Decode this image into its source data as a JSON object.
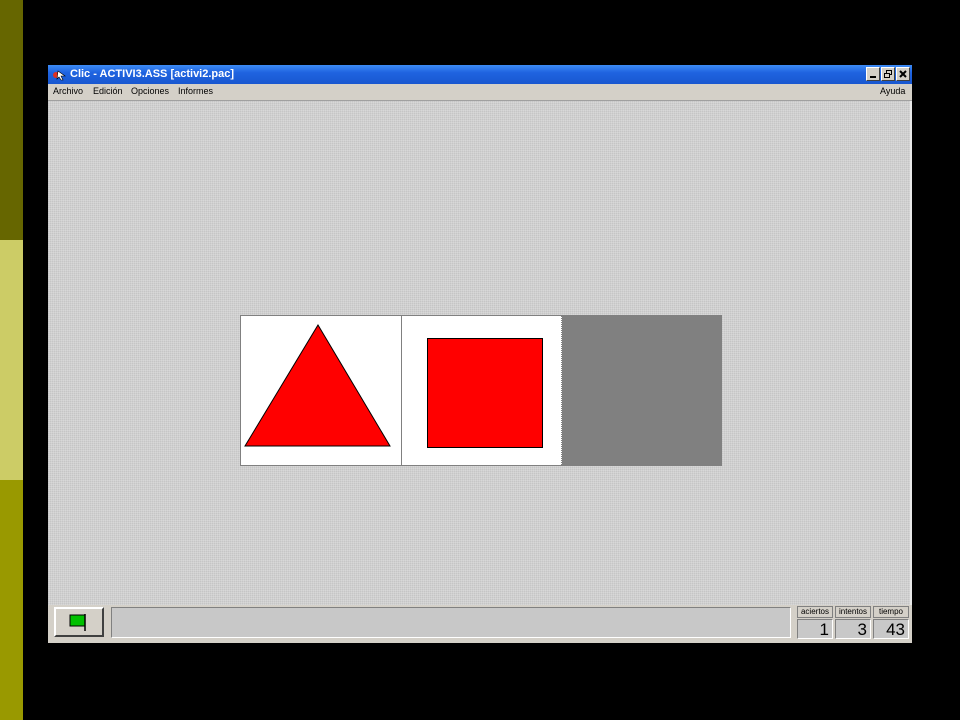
{
  "slide_stripes": {
    "colors": [
      "#666600",
      "#cccc66",
      "#999900"
    ]
  },
  "window": {
    "title": "Clic - ACTIVI3.ASS [activi2.pac]",
    "icon": "clic-app-icon",
    "controls": {
      "minimize_icon": "minimize-icon",
      "maximize_icon": "restore-icon",
      "close_icon": "close-icon"
    }
  },
  "menu": {
    "items": [
      "Archivo",
      "Edición",
      "Opciones",
      "Informes"
    ],
    "help": "Ayuda"
  },
  "board": {
    "cells": [
      {
        "shape": "triangle",
        "color": "#ff0000",
        "state": "filled"
      },
      {
        "shape": "square",
        "color": "#ff0000",
        "state": "filled"
      },
      {
        "shape": "empty",
        "color": "#808080",
        "state": "empty"
      }
    ]
  },
  "status": {
    "start_button_icon": "green-flag-icon",
    "counters": {
      "aciertos": {
        "label": "aciertos",
        "value": "1"
      },
      "intentos": {
        "label": "intentos",
        "value": "3"
      },
      "tiempo": {
        "label": "tiempo",
        "value": "43"
      }
    }
  }
}
